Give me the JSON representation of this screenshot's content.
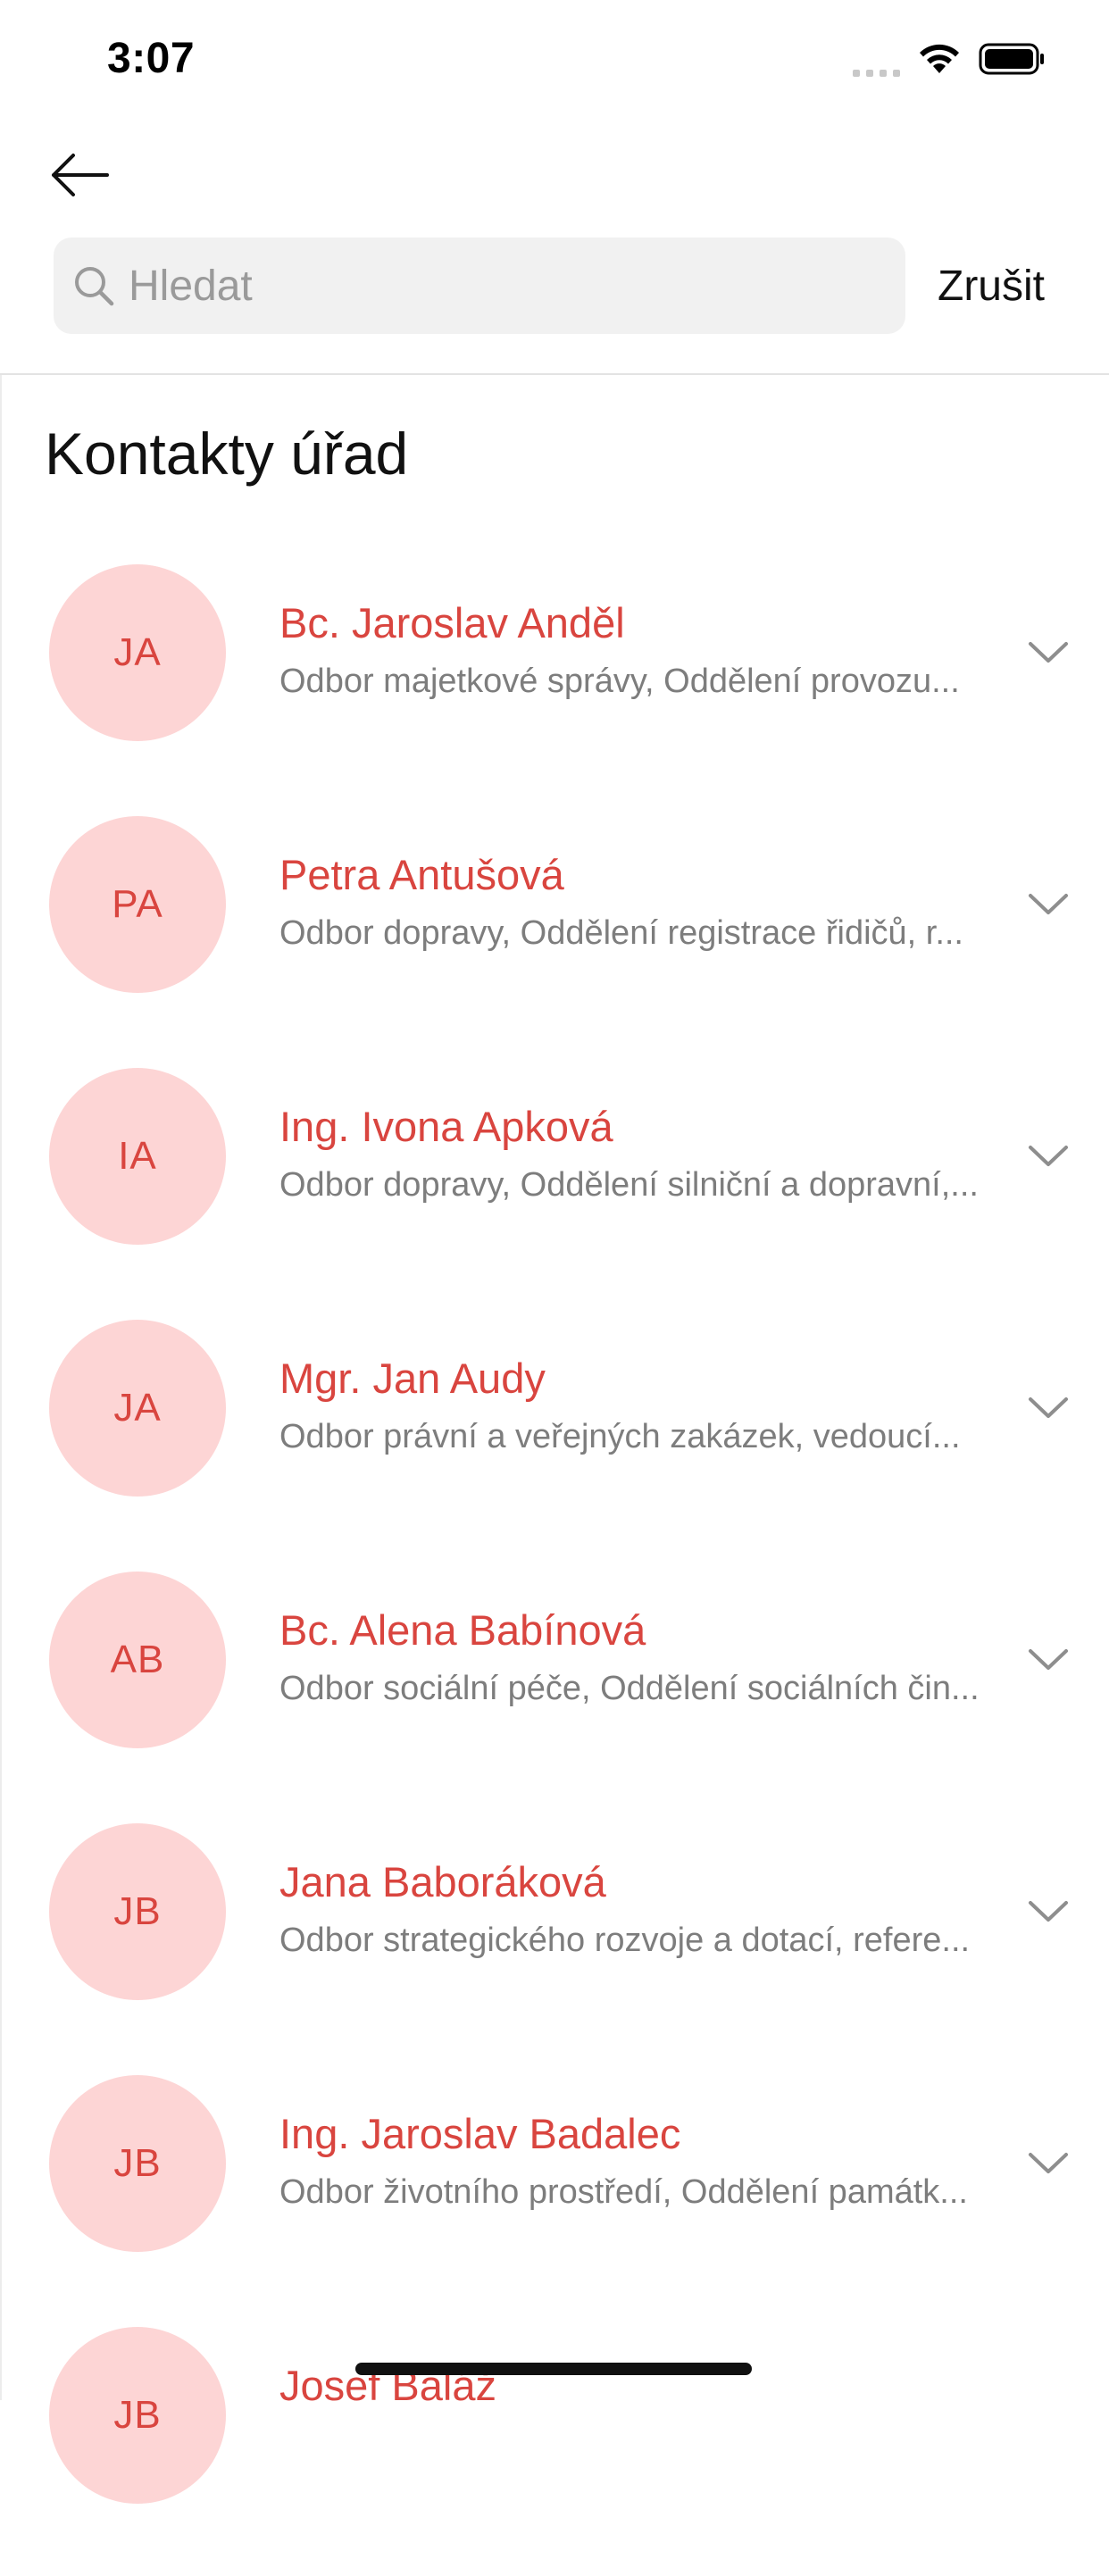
{
  "status_bar": {
    "time": "3:07",
    "icons": [
      "cellular-signal-icon",
      "wifi-icon",
      "battery-icon"
    ]
  },
  "header": {
    "back_icon": "arrow-left-icon",
    "search_placeholder": "Hledat",
    "search_value": "",
    "search_icon": "search-icon",
    "cancel_label": "Zrušit"
  },
  "section": {
    "title": "Kontakty úřad"
  },
  "colors": {
    "accent": "#d9453f",
    "avatar_bg": "#fdd5d5",
    "secondary_text": "#7d7d7d"
  },
  "contacts": [
    {
      "initials": "JA",
      "name": "Bc. Jaroslav Anděl",
      "department": "Odbor majetkové správy, Oddělení provozu..."
    },
    {
      "initials": "PA",
      "name": "Petra Antušová",
      "department": "Odbor dopravy, Oddělení registrace řidičů, r..."
    },
    {
      "initials": "IA",
      "name": "Ing. Ivona Apková",
      "department": "Odbor dopravy, Oddělení silniční a dopravní,..."
    },
    {
      "initials": "JA",
      "name": "Mgr. Jan Audy",
      "department": "Odbor právní a veřejných zakázek, vedoucí..."
    },
    {
      "initials": "AB",
      "name": "Bc. Alena Babínová",
      "department": "Odbor sociální péče, Oddělení sociálních čin..."
    },
    {
      "initials": "JB",
      "name": "Jana Baboráková",
      "department": "Odbor strategického rozvoje a dotací, refere..."
    },
    {
      "initials": "JB",
      "name": "Ing. Jaroslav Badalec",
      "department": "Odbor životního prostředí, Oddělení památk..."
    },
    {
      "initials": "JB",
      "name": "Josef Baláž",
      "department": ""
    }
  ]
}
